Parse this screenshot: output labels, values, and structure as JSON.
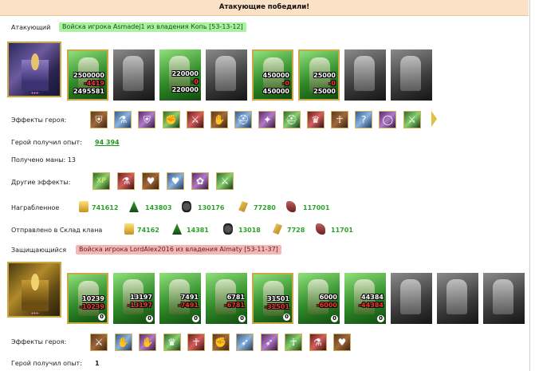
{
  "banner": "Атакующие победили!",
  "attacker": {
    "role_label": "Атакующий",
    "tag": "Войска игрока Asmadej1 из владения Копь [53-13-12]",
    "units": [
      {
        "lines": [
          "2500000",
          "-4419",
          "2495581"
        ],
        "colors": [
          "w",
          "r",
          "w"
        ]
      },
      {
        "lines": [],
        "colors": []
      },
      {
        "lines": [
          "220000",
          "-0",
          "220000"
        ],
        "colors": [
          "w",
          "r",
          "w"
        ]
      },
      {
        "lines": [],
        "colors": []
      },
      {
        "lines": [
          "450000",
          "-0",
          "450000"
        ],
        "colors": [
          "w",
          "r",
          "w"
        ]
      },
      {
        "lines": [
          "25000",
          "-0",
          "25000"
        ],
        "colors": [
          "w",
          "r",
          "w"
        ]
      },
      {
        "lines": [],
        "colors": []
      },
      {
        "lines": [],
        "colors": []
      }
    ],
    "effects_label": "Эффекты героя:",
    "effects": [
      "shield-icon",
      "potion-icon",
      "shield-icon",
      "gauntlet-icon",
      "sword-icon",
      "hand-icon",
      "helm-icon",
      "rune-icon",
      "helm-icon",
      "crown-icon",
      "spirit-icon",
      "question-icon",
      "ring-icon",
      "sword-icon"
    ],
    "xp_label": "Герой получил опыт:",
    "xp_value": "94 394",
    "mana_text": "Получено маны: 13",
    "other_label": "Другие эффекты:",
    "other_effects": [
      {
        "icon": "xp-icon",
        "text": "XP"
      },
      {
        "icon": "potion-icon",
        "text": ""
      },
      {
        "icon": "heart-icon",
        "text": ""
      },
      {
        "icon": "heart-icon",
        "text": ""
      },
      {
        "icon": "bag-icon",
        "text": ""
      },
      {
        "icon": "sword-icon",
        "text": ""
      }
    ],
    "loot_label": "Награбленное",
    "loot": [
      {
        "icon": "gold-icon",
        "value": "741612"
      },
      {
        "icon": "wood-icon",
        "value": "143803"
      },
      {
        "icon": "ore-icon",
        "value": "130176"
      },
      {
        "icon": "wheat-icon",
        "value": "77280"
      },
      {
        "icon": "stone-icon",
        "value": "117001"
      }
    ],
    "warehouse_label": "Отправлено в Склад клана",
    "warehouse": [
      {
        "icon": "gold-icon",
        "value": "74162"
      },
      {
        "icon": "wood-icon",
        "value": "14381"
      },
      {
        "icon": "ore-icon",
        "value": "13018"
      },
      {
        "icon": "wheat-icon",
        "value": "7728"
      },
      {
        "icon": "stone-icon",
        "value": "11701"
      }
    ]
  },
  "defender": {
    "role_label": "Защищающийся",
    "tag": "Войска игрока LordAlex2016 из владения Almaty [53-11-37]",
    "units": [
      {
        "lines": [
          "10239",
          "-10239"
        ],
        "colors": [
          "w",
          "r"
        ],
        "badge": "0"
      },
      {
        "lines": [
          "13197",
          "-13197"
        ],
        "colors": [
          "w",
          "r"
        ],
        "badge": "0"
      },
      {
        "lines": [
          "7491",
          "-7491"
        ],
        "colors": [
          "w",
          "r"
        ],
        "badge": "0"
      },
      {
        "lines": [
          "6781",
          "-6781"
        ],
        "colors": [
          "w",
          "r"
        ],
        "badge": "0"
      },
      {
        "lines": [
          "31501",
          "-31501"
        ],
        "colors": [
          "w",
          "r"
        ],
        "badge": "0"
      },
      {
        "lines": [
          "6000",
          "-6000"
        ],
        "colors": [
          "w",
          "r"
        ],
        "badge": "0"
      },
      {
        "lines": [
          "44384",
          "-44384"
        ],
        "colors": [
          "w",
          "r"
        ],
        "badge": "0"
      },
      {
        "lines": [],
        "colors": [],
        "badge": ""
      },
      {
        "lines": [],
        "colors": [],
        "badge": ""
      },
      {
        "lines": [],
        "colors": [],
        "badge": ""
      }
    ],
    "effects_label": "Эффекты героя:",
    "effects": [
      "sword-icon",
      "hand-icon",
      "hand-icon",
      "crown-icon",
      "spirit-icon",
      "gauntlet-icon",
      "bow-icon",
      "bow-icon",
      "spirit-icon",
      "potion-icon",
      "heart-icon"
    ],
    "xp_label": "Герой получил опыт:",
    "xp_value": "1"
  }
}
